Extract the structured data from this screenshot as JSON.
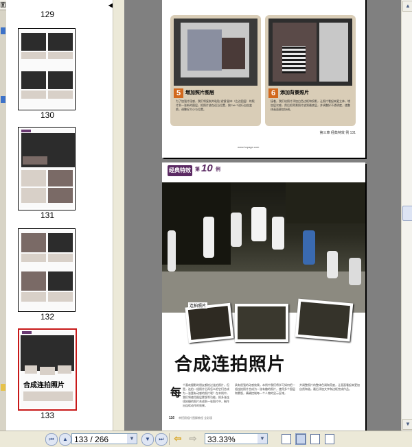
{
  "thumbnails": {
    "partial_label": "129",
    "items": [
      {
        "label": "130",
        "selected": false
      },
      {
        "label": "131",
        "selected": false
      },
      {
        "label": "132",
        "selected": false
      },
      {
        "label": "133",
        "selected": true
      }
    ],
    "thumb133_title": "合成连拍照片"
  },
  "page132": {
    "step5_number": "5",
    "step5_title": "增加照片图层",
    "step5_text": "为了加强片段感，我们将复制并粘贴“滤镜”副本（左边图层）的照片到一张新的图层，把照片放在适当位置，按Ctrl+T进行自由变换，调整好大小与位置。",
    "step6_number": "6",
    "step6_title": "添加背景照片",
    "step6_text": "接着，我们给照片添加白色边框和投影，让照片看起来更立体，增加层次感，然后把背景照片放到最底层，并调整好不透明度，使整体画面更加协调。",
    "footer_text": "第三章  经典特效  例  131",
    "bottom_text": "www.hxpage.com"
  },
  "page133": {
    "badge": "经典特效",
    "example_prefix": "第",
    "example_number": "10",
    "example_suffix": "例",
    "inset_label": "连拍照片",
    "title": "合成连拍照片",
    "dropcap": "每",
    "col1_text": "个喜欢摄影的朋友都拍过连拍照片，但是，连拍一组照片后再怎么把它们合成为一张富有动感的照片呢？在本例中，我们将使用图层蒙版等功能，把多张连续拍摄的照片合成到一张照片中，制作出连续动作的效果。",
    "col2_text": "具有很强的动感效果。本例中我们将学习如何把一组连拍照片合成为一张有趣的照片，使用多个图层和蒙版，精确控制每一个人物的显示区域，",
    "col3_text": "并调整照片的整体色调和亮度，让画面看起来更加自然和谐。最后添加文字和边框完成作品。",
    "page_number": "116",
    "footer_text": "单招照相片图解教程 全彩版"
  },
  "toolbar": {
    "page_value": "133 / 266",
    "zoom_value": "33.33%"
  },
  "colors": {
    "doc_background": "#808080",
    "accent_purple": "#5b2a63",
    "step_orange": "#d2691e",
    "selected_border": "#c81818"
  }
}
